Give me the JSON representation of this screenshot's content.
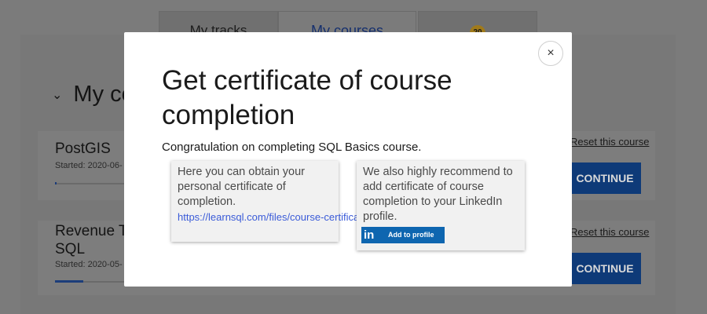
{
  "background": {
    "tabs": [
      {
        "label": "My tracks"
      },
      {
        "label": "My courses"
      },
      {
        "badge": "20"
      }
    ],
    "section_title": "My courses",
    "courses": [
      {
        "title": "PostGIS",
        "started": "Started: 2020-06-",
        "reset_label": "Reset this course",
        "continue_label": "CONTINUE"
      },
      {
        "title_line1": "Revenue T",
        "title_line2": "SQL",
        "started": "Started: 2020-05-",
        "reset_label": "Reset this course",
        "continue_label": "CONTINUE"
      }
    ]
  },
  "modal": {
    "close_symbol": "×",
    "title": "Get certificate of course completion",
    "subtitle": "Congratulation on completing SQL Basics course.",
    "left_card": {
      "text": "Here you can obtain your personal certificate of completion.",
      "link": "https://learnsql.com/files/course-certificate/TyzfXeeyZwFHnkKIzeIkFva"
    },
    "right_card": {
      "text": "We also highly recommend to add certificate of course completion to your LinkedIn profile.",
      "linkedin_logo": "in",
      "button_label": "Add to profile"
    }
  },
  "colors": {
    "overlay": "#7a7a7a",
    "accent": "#0e66b0",
    "link": "#3a5bd8",
    "continue": "#0e3a78"
  }
}
